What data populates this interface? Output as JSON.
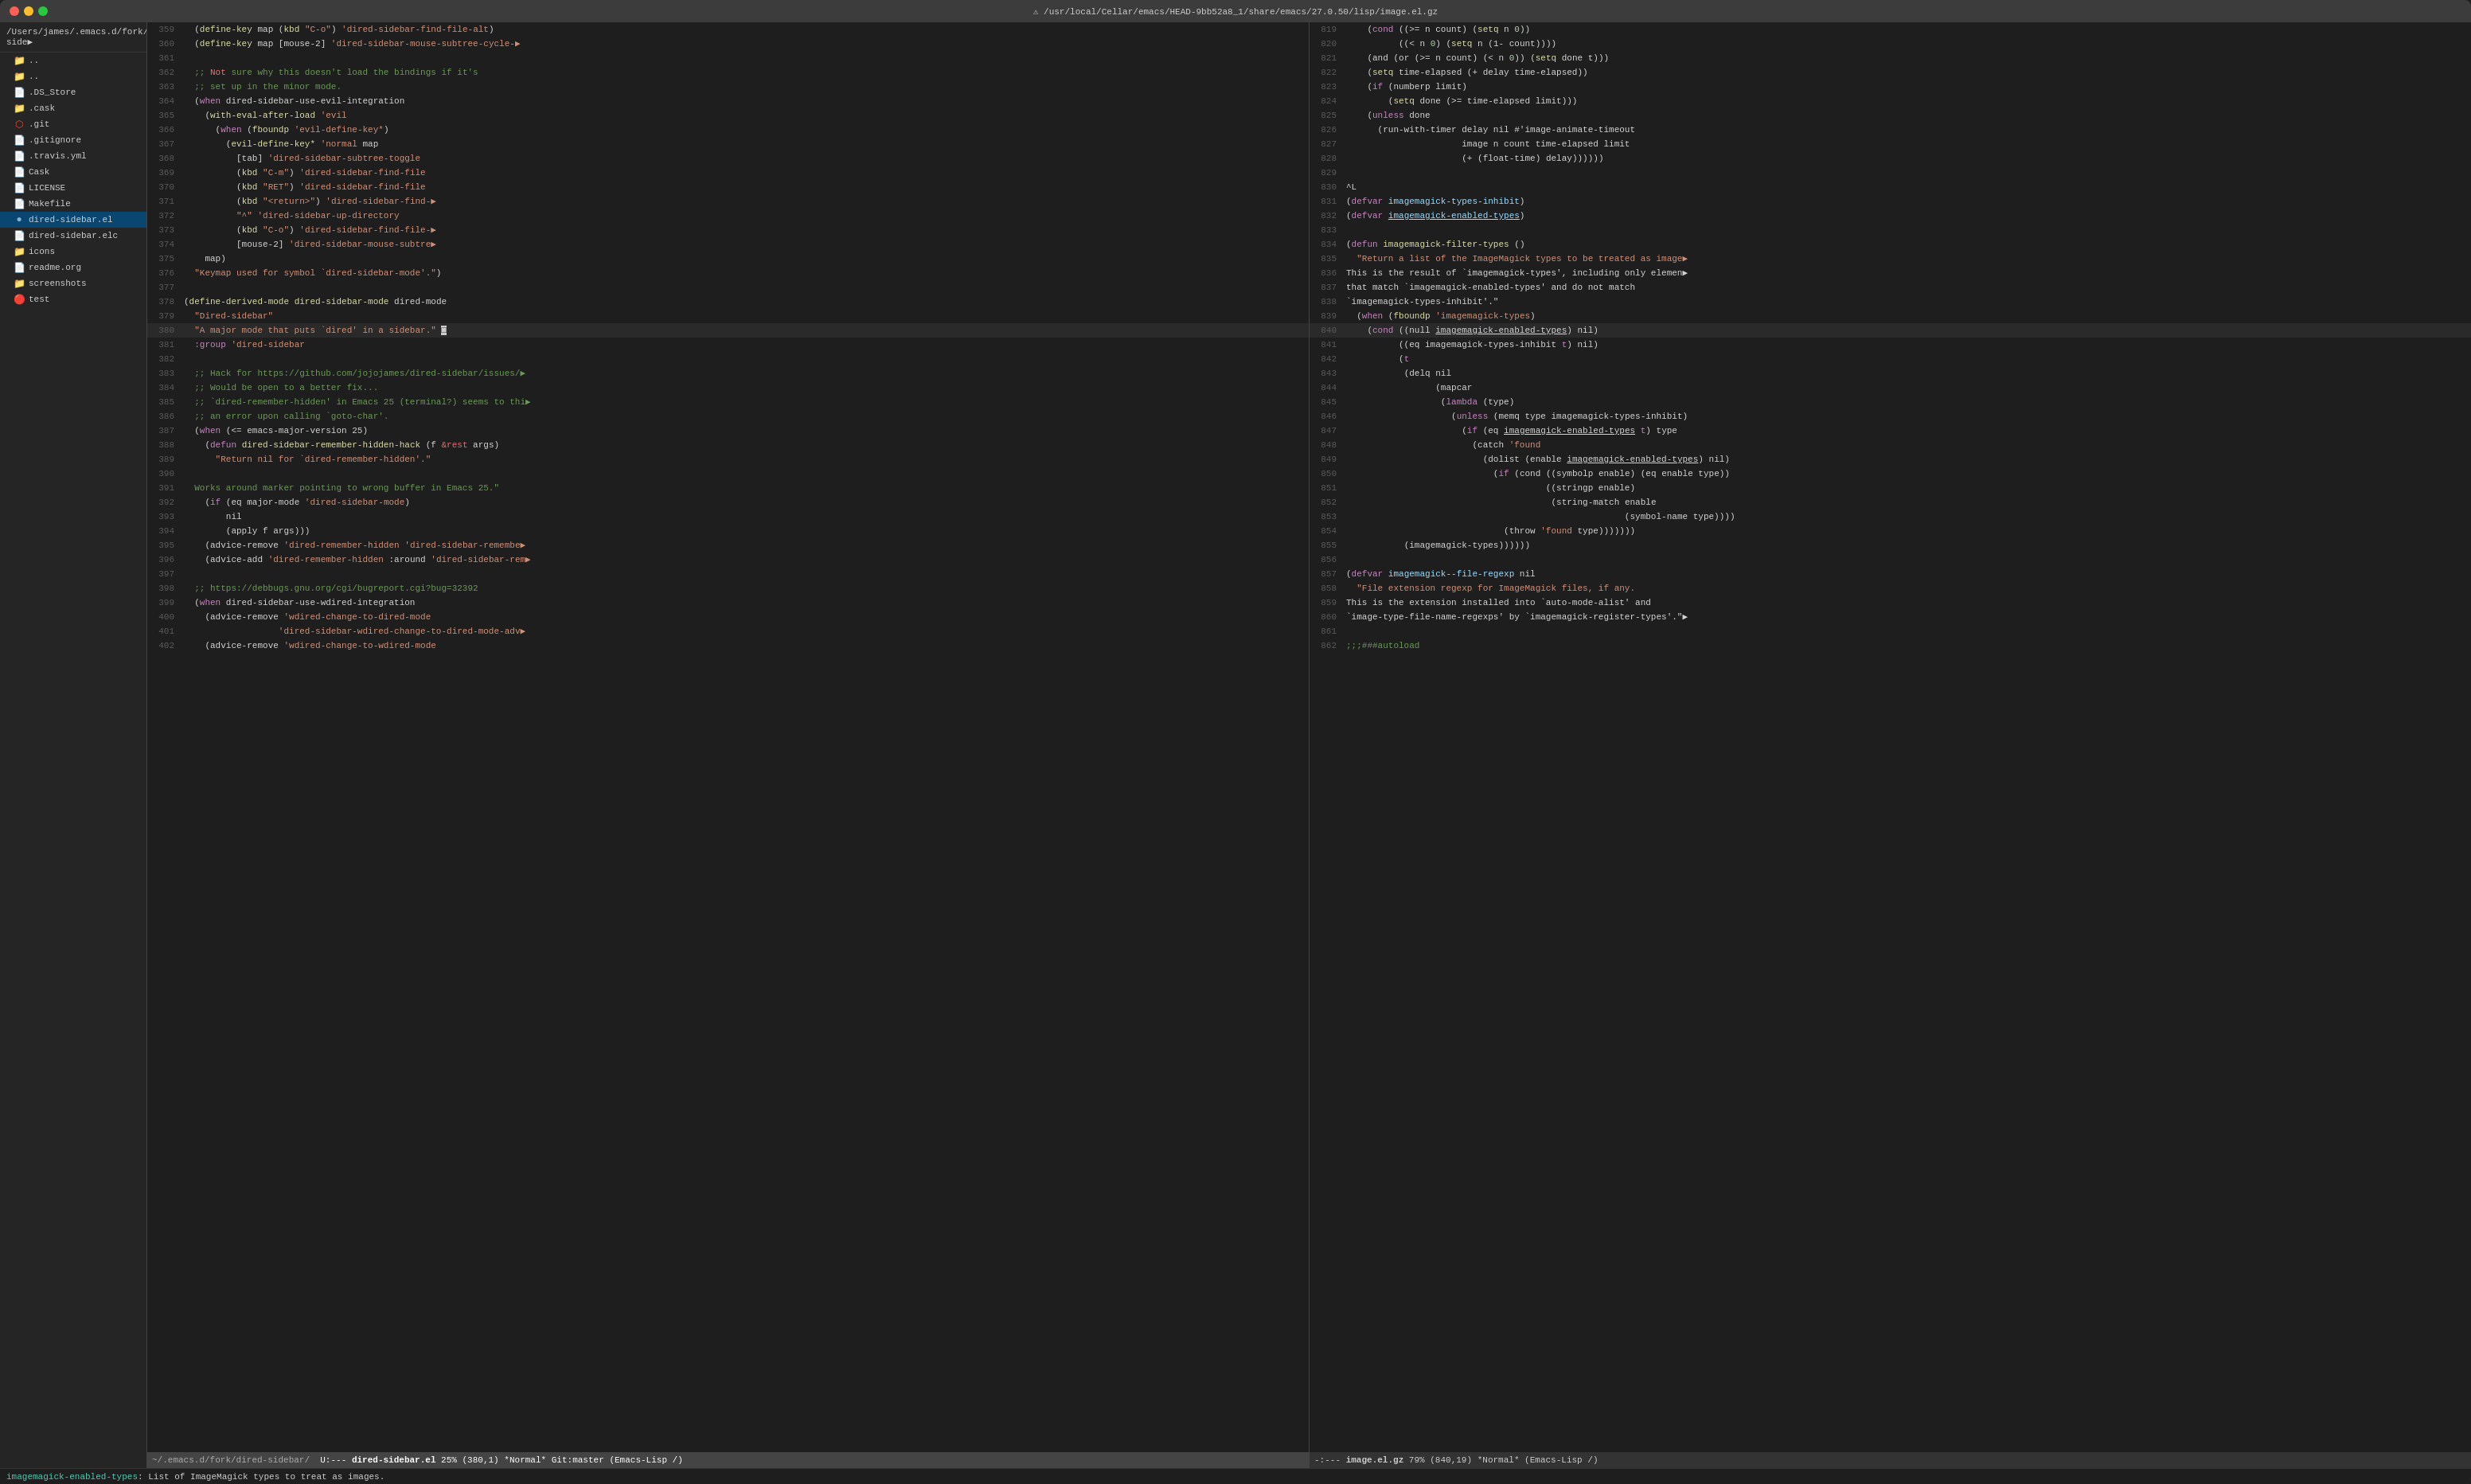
{
  "window": {
    "title": "⚠ /usr/local/Cellar/emacs/HEAD-9bb52a8_1/share/emacs/27.0.50/lisp/image.el.gz"
  },
  "sidebar": {
    "header": "/Users/james/.emacs.d/fork/dired-side▶",
    "items": [
      {
        "label": "..",
        "icon": "folder",
        "indent": 0
      },
      {
        "label": "..",
        "icon": "folder",
        "indent": 0
      },
      {
        "label": ".DS_Store",
        "icon": "file",
        "indent": 1
      },
      {
        "label": ".cask",
        "icon": "folder",
        "indent": 1
      },
      {
        "label": ".git",
        "icon": "git",
        "indent": 1
      },
      {
        "label": ".gitignore",
        "icon": "file",
        "indent": 1
      },
      {
        "label": ".travis.yml",
        "icon": "file",
        "indent": 1
      },
      {
        "label": "Cask",
        "icon": "file",
        "indent": 1
      },
      {
        "label": "LICENSE",
        "icon": "file",
        "indent": 1
      },
      {
        "label": "Makefile",
        "icon": "file",
        "indent": 1
      },
      {
        "label": "dired-sidebar.el",
        "icon": "el",
        "indent": 1,
        "active": true
      },
      {
        "label": "dired-sidebar.elc",
        "icon": "file",
        "indent": 1
      },
      {
        "label": "icons",
        "icon": "folder",
        "indent": 1
      },
      {
        "label": "readme.org",
        "icon": "file",
        "indent": 1
      },
      {
        "label": "screenshots",
        "icon": "folder",
        "indent": 1
      },
      {
        "label": "test",
        "icon": "test",
        "indent": 1
      }
    ]
  },
  "left_pane": {
    "lines": [
      {
        "num": "359",
        "content": "  (define-key map (kbd \"C-o\") 'dired-sidebar-find-file-alt)"
      },
      {
        "num": "360",
        "content": "  (define-key map [mouse-2] 'dired-sidebar-mouse-subtree-cycle-▶"
      },
      {
        "num": "361",
        "content": ""
      },
      {
        "num": "362",
        "content": "  ;; Not sure why this doesn't load the bindings if it's",
        "comment": true
      },
      {
        "num": "363",
        "content": "  ;; set up in the minor mode.",
        "comment": true
      },
      {
        "num": "364",
        "content": "  (when dired-sidebar-use-evil-integration"
      },
      {
        "num": "365",
        "content": "    (with-eval-after-load 'evil"
      },
      {
        "num": "366",
        "content": "      (when (fboundp 'evil-define-key*)"
      },
      {
        "num": "367",
        "content": "        (evil-define-key* 'normal map"
      },
      {
        "num": "368",
        "content": "          [tab] 'dired-sidebar-subtree-toggle"
      },
      {
        "num": "369",
        "content": "          (kbd \"C-m\") 'dired-sidebar-find-file"
      },
      {
        "num": "370",
        "content": "          (kbd \"RET\") 'dired-sidebar-find-file"
      },
      {
        "num": "371",
        "content": "          (kbd \"<return>\") 'dired-sidebar-find-▶"
      },
      {
        "num": "372",
        "content": "          \"^\" 'dired-sidebar-up-directory"
      },
      {
        "num": "373",
        "content": "          (kbd \"C-o\") 'dired-sidebar-find-file-▶"
      },
      {
        "num": "374",
        "content": "          [mouse-2] 'dired-sidebar-mouse-subtre▶"
      },
      {
        "num": "375",
        "content": "    map)"
      },
      {
        "num": "376",
        "content": "  \"Keymap used for symbol `dired-sidebar-mode'.\")"
      },
      {
        "num": "377",
        "content": ""
      },
      {
        "num": "378",
        "content": "(define-derived-mode dired-sidebar-mode dired-mode"
      },
      {
        "num": "379",
        "content": "  \"Dired-sidebar\""
      },
      {
        "num": "380",
        "content": "  \"A major mode that puts `dired' in a sidebar.\"",
        "current": true
      },
      {
        "num": "381",
        "content": "  :group 'dired-sidebar"
      },
      {
        "num": "382",
        "content": ""
      },
      {
        "num": "383",
        "content": "  ;; Hack for https://github.com/jojojames/dired-sidebar/issues/▶",
        "comment": true
      },
      {
        "num": "384",
        "content": "  ;; Would be open to a better fix...",
        "comment": true
      },
      {
        "num": "385",
        "content": "  ;; `dired-remember-hidden' in Emacs 25 (terminal?) seems to thi▶",
        "comment": true
      },
      {
        "num": "386",
        "content": "  ;; an error upon calling `goto-char'.",
        "comment": true
      },
      {
        "num": "387",
        "content": "  (when (<= emacs-major-version 25)"
      },
      {
        "num": "388",
        "content": "    (defun dired-sidebar-remember-hidden-hack (f &rest args)"
      },
      {
        "num": "389",
        "content": "      \"Return nil for `dired-remember-hidden'.\""
      },
      {
        "num": "390",
        "content": ""
      },
      {
        "num": "391",
        "content": "  Works around marker pointing to wrong buffer in Emacs 25.\"",
        "comment": true
      },
      {
        "num": "392",
        "content": "    (if (eq major-mode 'dired-sidebar-mode)"
      },
      {
        "num": "393",
        "content": "        nil"
      },
      {
        "num": "394",
        "content": "        (apply f args)))"
      },
      {
        "num": "395",
        "content": "    (advice-remove 'dired-remember-hidden 'dired-sidebar-remembe▶"
      },
      {
        "num": "396",
        "content": "    (advice-add 'dired-remember-hidden :around 'dired-sidebar-rem▶"
      },
      {
        "num": "397",
        "content": ""
      },
      {
        "num": "398",
        "content": "  ;; https://debbugs.gnu.org/cgi/bugreport.cgi?bug=32392",
        "comment": true
      },
      {
        "num": "399",
        "content": "  (when dired-sidebar-use-wdired-integration"
      },
      {
        "num": "400",
        "content": "    (advice-remove 'wdired-change-to-dired-mode"
      },
      {
        "num": "401",
        "content": "                  'dired-sidebar-wdired-change-to-dired-mode-adv▶"
      },
      {
        "num": "402",
        "content": "    (advice-remove 'wdired-change-to-wdired-mode"
      }
    ],
    "modeline": {
      "encoding": "U:---",
      "filename": "dired-sidebar.el",
      "position": "25% (380,1)",
      "mode": "*Normal*",
      "git": "Git:master",
      "major_mode": "(Emacs-Lisp /)"
    }
  },
  "right_pane": {
    "lines": [
      {
        "num": "819",
        "content": "    (cond ((>= n count) (setq n 0))"
      },
      {
        "num": "820",
        "content": "          ((< n 0) (setq n (1- count))))"
      },
      {
        "num": "821",
        "content": "    (and (or (>= n count) (< n 0)) (setq done t)))"
      },
      {
        "num": "822",
        "content": "    (setq time-elapsed (+ delay time-elapsed))"
      },
      {
        "num": "823",
        "content": "    (if (numberp limit)"
      },
      {
        "num": "824",
        "content": "        (setq done (>= time-elapsed limit)))"
      },
      {
        "num": "825",
        "content": "    (unless done"
      },
      {
        "num": "826",
        "content": "      (run-with-timer delay nil #'image-animate-timeout"
      },
      {
        "num": "827",
        "content": "                      image n count time-elapsed limit"
      },
      {
        "num": "828",
        "content": "                      (+ (float-time) delay))))))"
      },
      {
        "num": "829",
        "content": ""
      },
      {
        "num": "830",
        "content": "^L"
      },
      {
        "num": "831",
        "content": "(defvar imagemagick-types-inhibit)"
      },
      {
        "num": "832",
        "content": "(defvar imagemagick-enabled-types)"
      },
      {
        "num": "833",
        "content": ""
      },
      {
        "num": "834",
        "content": "(defun imagemagick-filter-types ()"
      },
      {
        "num": "835",
        "content": "  \"Return a list of the ImageMagick types to be treated as image▶"
      },
      {
        "num": "836",
        "content": "This is the result of `imagemagick-types', including only elemen▶"
      },
      {
        "num": "837",
        "content": "that match `imagemagick-enabled-types' and do not match"
      },
      {
        "num": "838",
        "content": "`imagemagick-types-inhibit'.\""
      },
      {
        "num": "839",
        "content": "  (when (fboundp 'imagemagick-types)"
      },
      {
        "num": "840",
        "content": "    (cond ((null imagemagick-enabled-types) nil)",
        "current": true
      },
      {
        "num": "841",
        "content": "          ((eq imagemagick-types-inhibit t) nil)"
      },
      {
        "num": "842",
        "content": "          (t"
      },
      {
        "num": "843",
        "content": "           (delq nil"
      },
      {
        "num": "844",
        "content": "                 (mapcar"
      },
      {
        "num": "845",
        "content": "                  (lambda (type)"
      },
      {
        "num": "846",
        "content": "                    (unless (memq type imagemagick-types-inhibit)"
      },
      {
        "num": "847",
        "content": "                      (if (eq imagemagick-enabled-types t) type"
      },
      {
        "num": "848",
        "content": "                        (catch 'found"
      },
      {
        "num": "849",
        "content": "                          (dolist (enable imagemagick-enabled-types) nil)"
      },
      {
        "num": "850",
        "content": "                            (if (cond ((symbolp enable) (eq enable type))"
      },
      {
        "num": "851",
        "content": "                                      ((stringp enable)"
      },
      {
        "num": "852",
        "content": "                                       (string-match enable"
      },
      {
        "num": "853",
        "content": "                                                     (symbol-name type))))"
      },
      {
        "num": "854",
        "content": "                              (throw 'found type)))))))"
      },
      {
        "num": "855",
        "content": "           (imagemagick-types))))))"
      },
      {
        "num": "856",
        "content": ""
      },
      {
        "num": "857",
        "content": "(defvar imagemagick--file-regexp nil"
      },
      {
        "num": "858",
        "content": "  \"File extension regexp for ImageMagick files, if any."
      },
      {
        "num": "859",
        "content": "This is the extension installed into `auto-mode-alist' and"
      },
      {
        "num": "860",
        "content": "`image-type-file-name-regexps' by `imagemagick-register-types'.\"▶"
      },
      {
        "num": "861",
        "content": ""
      },
      {
        "num": "862",
        "content": ";;;###autoload"
      }
    ],
    "modeline": {
      "encoding": "-:---",
      "filename": "image.el.gz",
      "position": "79% (840,19)",
      "mode": "*Normal*",
      "major_mode": "(Emacs-Lisp /)"
    }
  },
  "echo_area": {
    "label": "imagemagick-enabled-types",
    "text": ": List of ImageMagick types to treat as images."
  }
}
